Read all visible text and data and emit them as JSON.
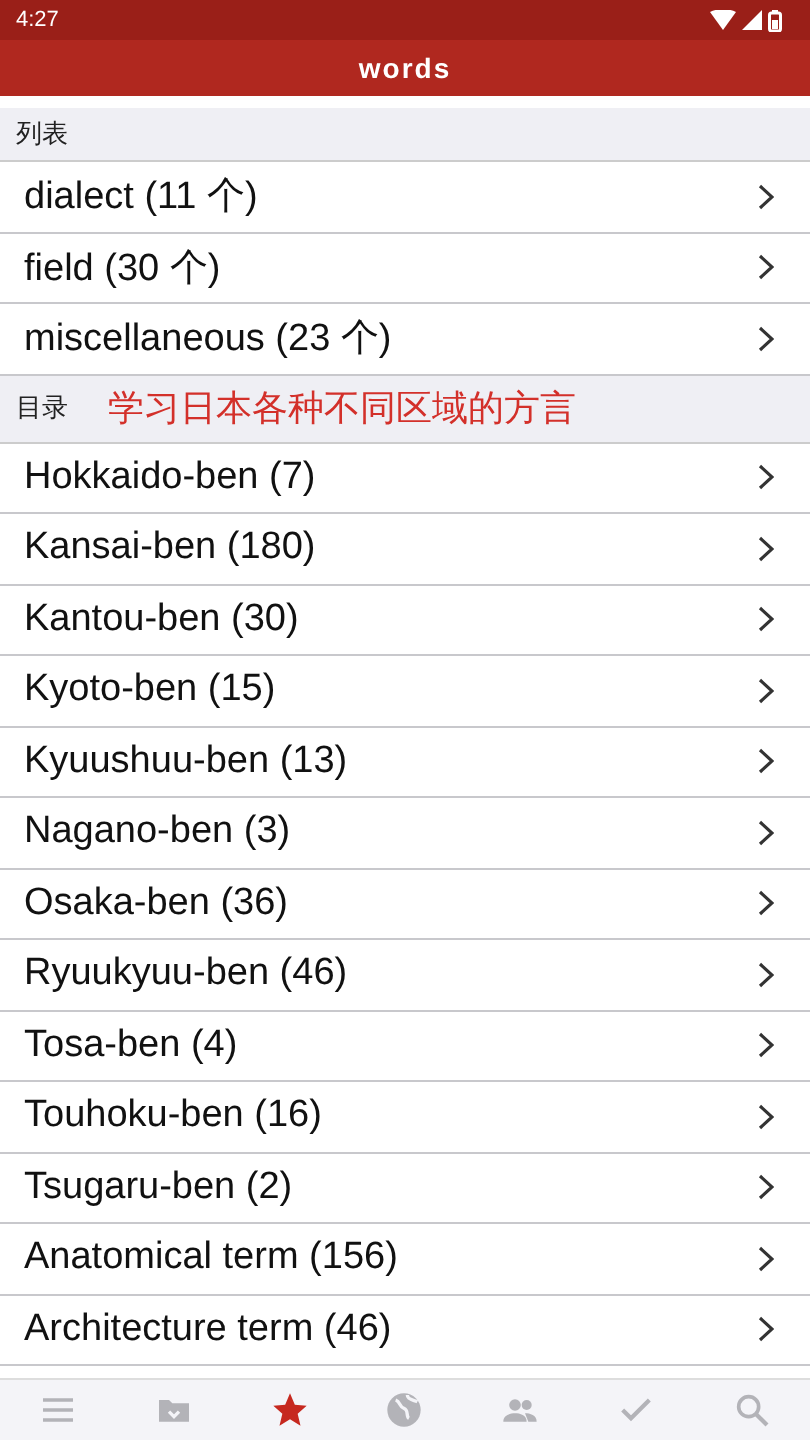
{
  "status_bar": {
    "time": "4:27"
  },
  "header": {
    "title": "words"
  },
  "sections": [
    {
      "title": "列表",
      "items": [
        {
          "label": "dialect (11 个)"
        },
        {
          "label": "field (30 个)"
        },
        {
          "label": "miscellaneous (23 个)"
        }
      ]
    },
    {
      "title": "目录",
      "subtitle": "学习日本各种不同区域的方言",
      "items": [
        {
          "label": "Hokkaido-ben (7)"
        },
        {
          "label": "Kansai-ben (180)"
        },
        {
          "label": "Kantou-ben (30)"
        },
        {
          "label": "Kyoto-ben (15)"
        },
        {
          "label": "Kyuushuu-ben (13)"
        },
        {
          "label": "Nagano-ben (3)"
        },
        {
          "label": "Osaka-ben (36)"
        },
        {
          "label": "Ryuukyuu-ben (46)"
        },
        {
          "label": "Tosa-ben (4)"
        },
        {
          "label": "Touhoku-ben (16)"
        },
        {
          "label": "Tsugaru-ben (2)"
        },
        {
          "label": "Anatomical term (156)"
        },
        {
          "label": "Architecture term (46)"
        }
      ]
    }
  ],
  "tab_bar": [
    {
      "kind": "menu",
      "selected": false
    },
    {
      "kind": "folder",
      "selected": false
    },
    {
      "kind": "star",
      "selected": true
    },
    {
      "kind": "globe",
      "selected": false
    },
    {
      "kind": "people",
      "selected": false
    },
    {
      "kind": "check",
      "selected": false
    },
    {
      "kind": "search",
      "selected": false
    }
  ]
}
